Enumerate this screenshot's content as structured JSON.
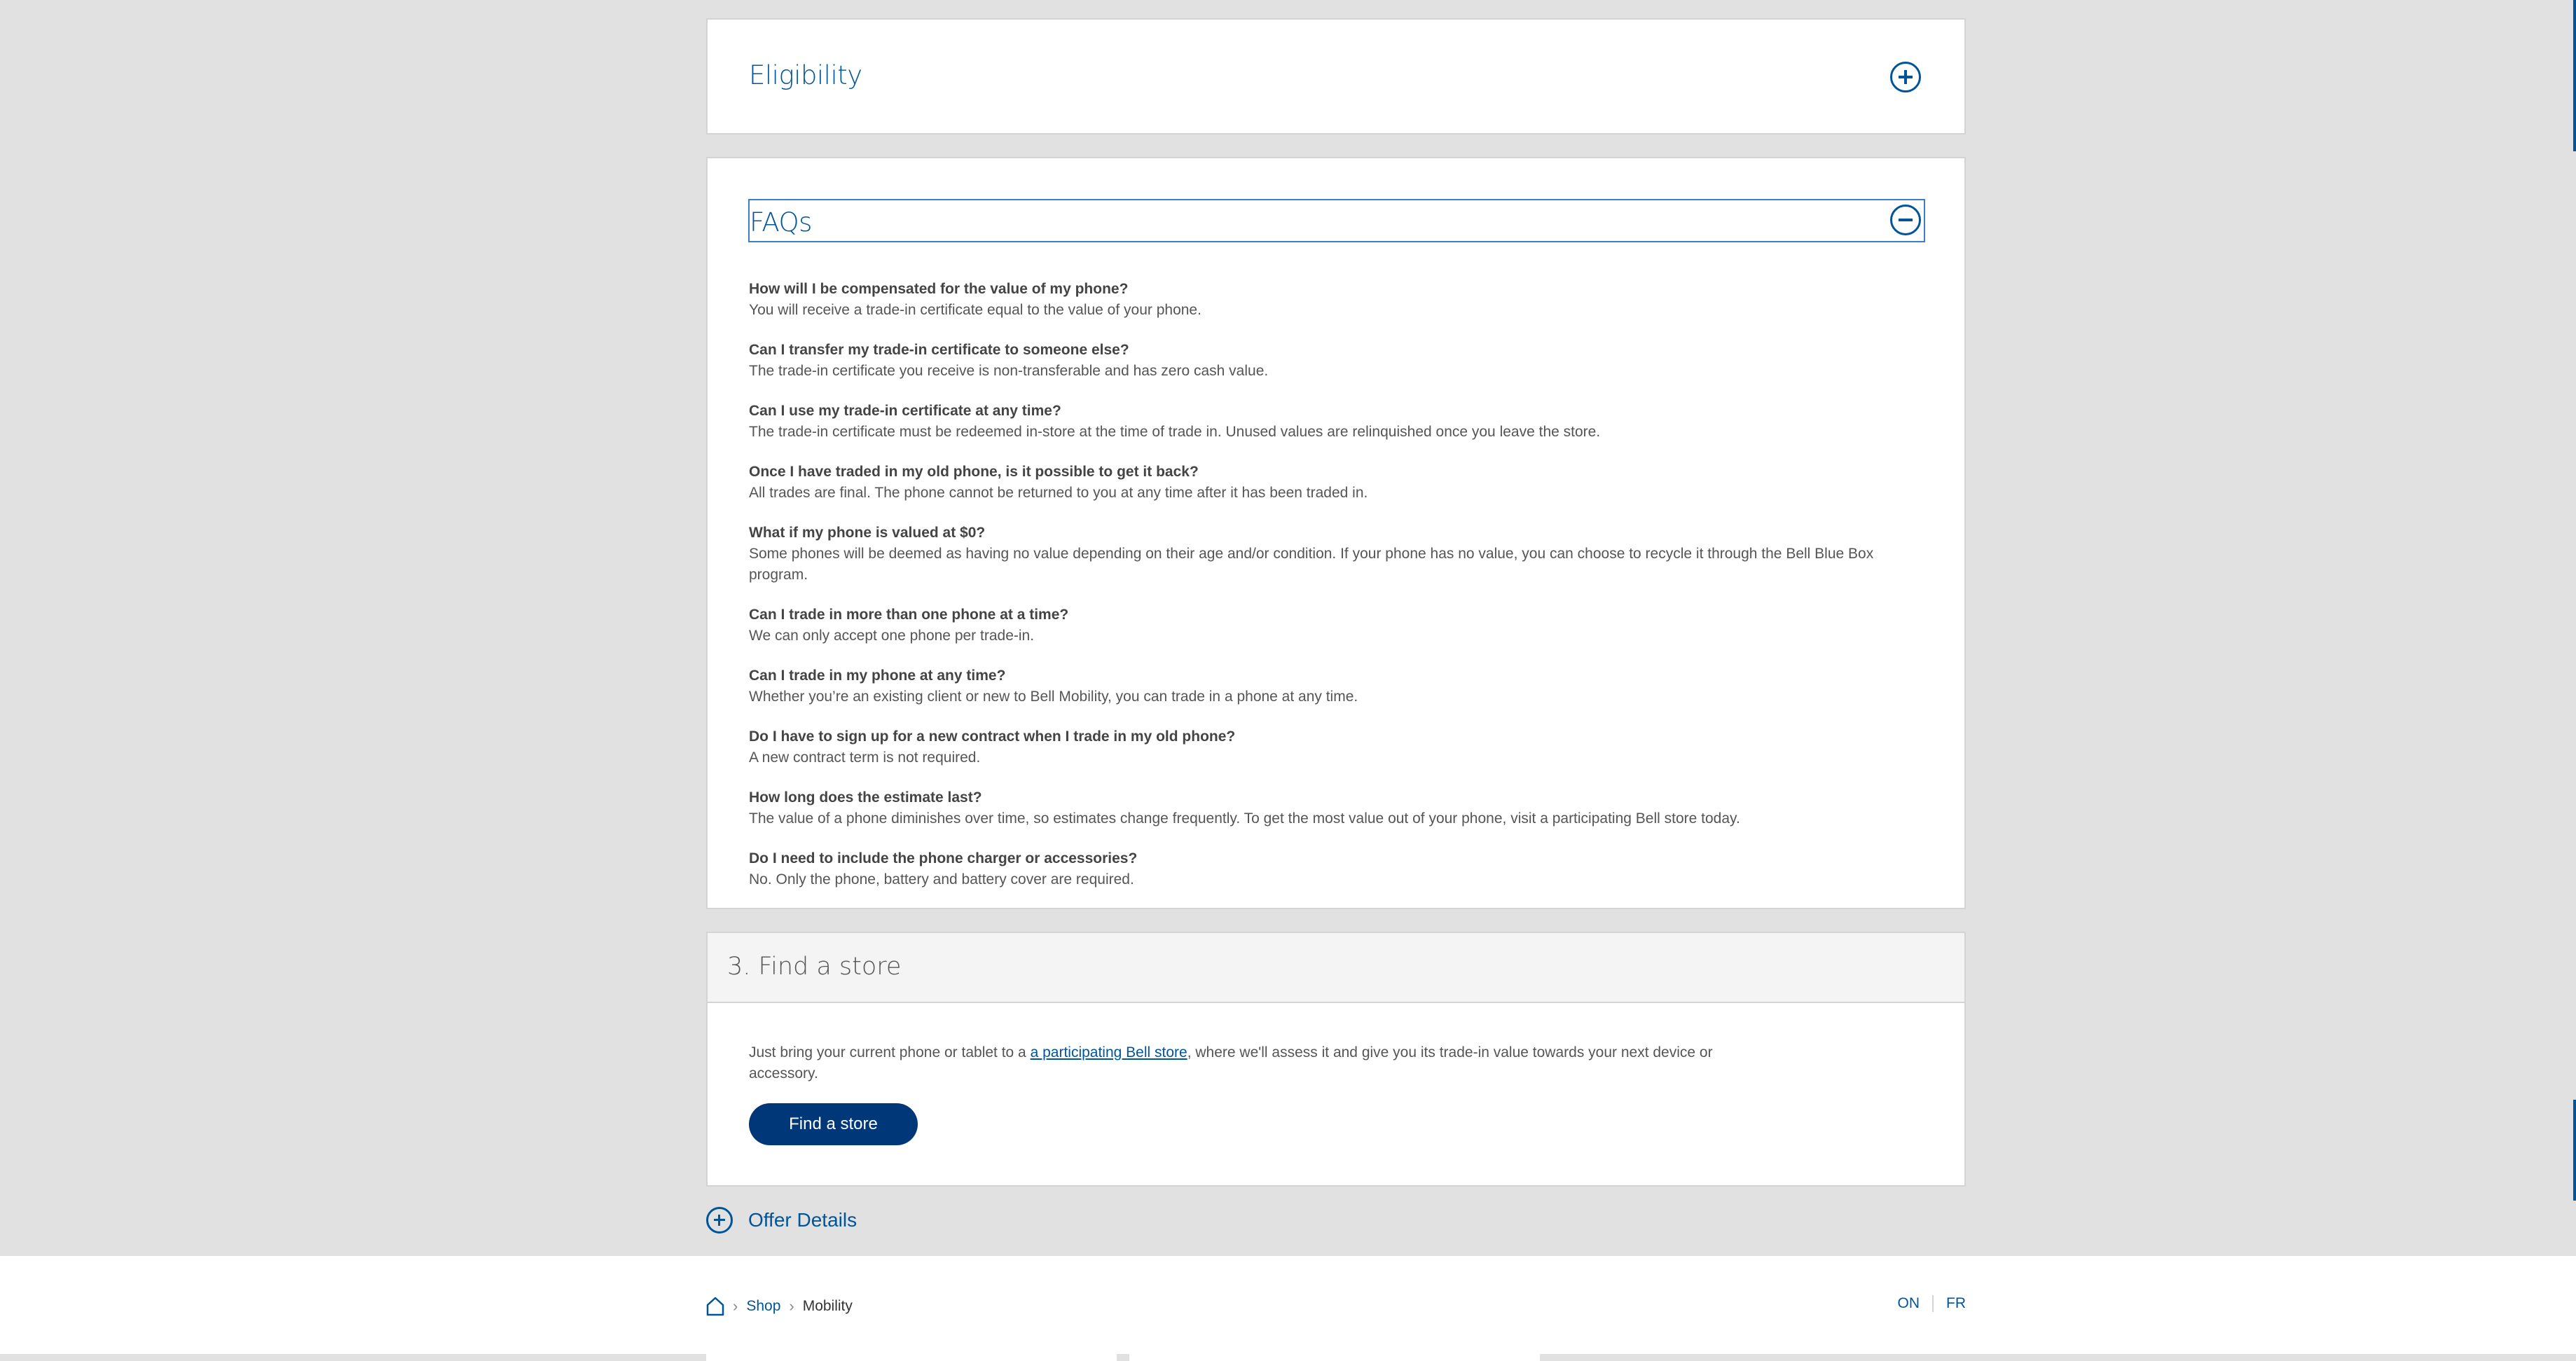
{
  "eligibility": {
    "title": "Eligibility",
    "icon": "plus-circle-icon"
  },
  "faqs": {
    "title": "FAQs",
    "icon": "minus-circle-icon",
    "items": [
      {
        "q": "How will I be compensated for the value of my phone?",
        "a": "You will receive a trade-in certificate equal to the value of your phone."
      },
      {
        "q": "Can I transfer my trade-in certificate to someone else?",
        "a": "The trade-in certificate you receive is non-transferable and has zero cash value."
      },
      {
        "q": "Can I use my trade-in certificate at any time?",
        "a": "The trade-in certificate must be redeemed in-store at the time of trade in. Unused values are relinquished once you leave the store."
      },
      {
        "q": "Once I have traded in my old phone, is it possible to get it back?",
        "a": "All trades are final. The phone cannot be returned to you at any time after it has been traded in."
      },
      {
        "q": "What if my phone is valued at $0?",
        "a": "Some phones will be deemed as having no value depending on their age and/or condition. If your phone has no value, you can choose to recycle it through the Bell Blue Box program."
      },
      {
        "q": "Can I trade in more than one phone at a time?",
        "a": "We can only accept one phone per trade-in."
      },
      {
        "q": "Can I trade in my phone at any time?",
        "a": "Whether you’re an existing client or new to Bell Mobility, you can trade in a phone at any time."
      },
      {
        "q": "Do I have to sign up for a new contract when I trade in my old phone?",
        "a": "A new contract term is not required."
      },
      {
        "q": "How long does the estimate last?",
        "a": "The value of a phone diminishes over time, so estimates change frequently. To get the most value out of your phone, visit a participating Bell store today."
      },
      {
        "q": "Do I need to include the phone charger or accessories?",
        "a": "No. Only the phone, battery and battery cover are required."
      }
    ]
  },
  "store": {
    "title": "3. Find a store",
    "text_before": "Just bring your current phone or tablet to a ",
    "link": "a participating Bell store",
    "text_after": ", where we'll assess it and give you its trade-in value towards your next device or accessory.",
    "button": "Find a store"
  },
  "offer": {
    "label": "Offer Details",
    "icon": "plus-circle-icon"
  },
  "footer": {
    "breadcrumb": [
      {
        "label": "Shop"
      },
      {
        "label": "Mobility"
      }
    ],
    "home_icon": "home-icon",
    "region": "ON",
    "language": "FR"
  },
  "colors": {
    "accent": "#00549a",
    "button": "#003778",
    "page_bg": "#e1e1e1"
  }
}
